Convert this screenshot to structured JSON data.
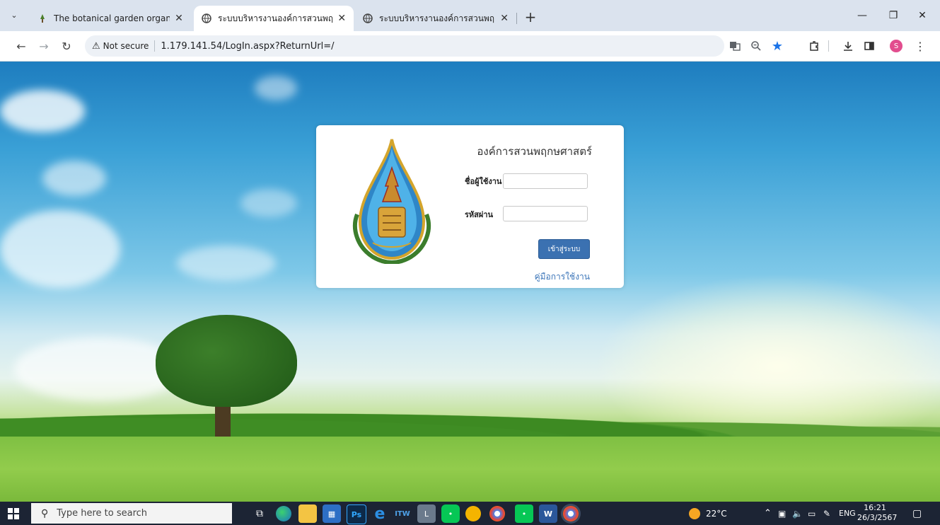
{
  "browser": {
    "tabs": [
      {
        "title": "The botanical garden organizat",
        "active": false,
        "icon": "plant-favicon-icon"
      },
      {
        "title": "ระบบบริหารงานองค์การสวนพฤกษศา",
        "active": true,
        "icon": "globe-icon"
      },
      {
        "title": "ระบบบริหารงานองค์การสวนพฤกษศา",
        "active": false,
        "icon": "globe-icon"
      }
    ],
    "new_tab_label": "+",
    "tab_search_icon": "chevron-down-icon",
    "security_label": "Not secure",
    "url": "1.179.141.54/LogIn.aspx?ReturnUrl=/",
    "profile_initial": "S"
  },
  "login": {
    "org_name": "องค์การสวนพฤกษศาสตร์",
    "username_label": "ชื่อผู้ใช้งาน",
    "username_value": "",
    "password_label": "รหัสผ่าน",
    "password_value": "",
    "submit_label": "เข้าสู่ระบบ",
    "manual_link": "คู่มือการใช้งาน"
  },
  "taskbar": {
    "search_placeholder": "Type here to search",
    "weather": "22°C",
    "language": "ENG",
    "time": "16:21",
    "date": "26/3/2567"
  },
  "colors": {
    "accent_button": "#3b71b1",
    "link": "#3a74b8",
    "taskbar": "#1c2434"
  }
}
